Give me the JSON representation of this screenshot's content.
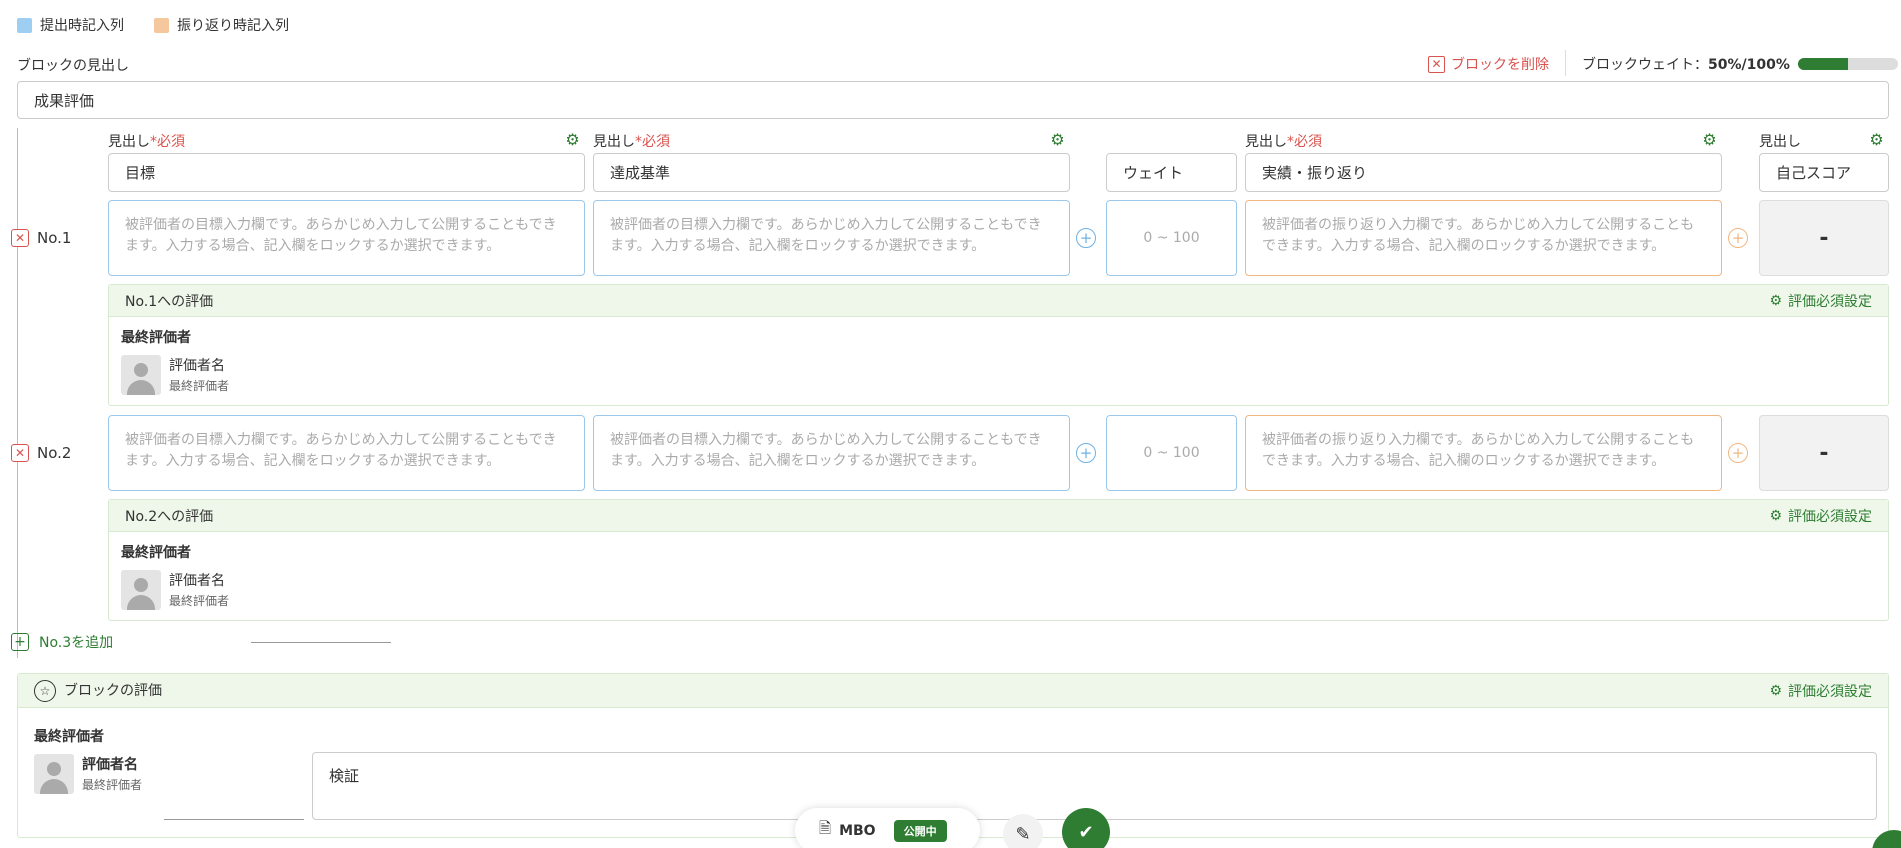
{
  "legend": [
    {
      "label": "提出時記入列",
      "color": "#9ecff3"
    },
    {
      "label": "振り返り時記入列",
      "color": "#f5c79d"
    }
  ],
  "block": {
    "heading_label": "ブロックの見出し",
    "title_value": "成果評価",
    "delete_label": "ブロックを削除",
    "weight_label": "ブロックウェイト：",
    "weight_value": "50%/100%",
    "weight_progress": 0.5
  },
  "columns": {
    "heading": "見出し",
    "required": "*必須",
    "goal": "目標",
    "criteria": "達成基準",
    "weight": "ウェイト",
    "result": "実績・振り返り",
    "self_score": "自己スコア"
  },
  "placeholders": {
    "goal": "被評価者の目標入力欄です。あらかじめ入力して公開することもできます。入力する場合、記入欄をロックするか選択できます。",
    "criteria": "被評価者の目標入力欄です。あらかじめ入力して公開することもできます。入力する場合、記入欄をロックするか選択できます。",
    "weight": "0 ~ 100",
    "result": "被評価者の振り返り入力欄です。あらかじめ入力して公開することもできます。入力する場合、記入欄のロックするか選択できます。"
  },
  "rows": [
    {
      "label": "No.1",
      "score": "-",
      "eval_title": "No.1への評価"
    },
    {
      "label": "No.2",
      "score": "-",
      "eval_title": "No.2への評価"
    }
  ],
  "evaluation": {
    "setting_label": "評価必須設定",
    "final_evaluator": "最終評価者",
    "evaluator_name": "評価者名",
    "evaluator_role": "最終評価者"
  },
  "add_row_label": "No.3を追加",
  "block_eval": {
    "title": "ブロックの評価",
    "setting_label": "評価必須設定",
    "final_evaluator": "最終評価者",
    "evaluator_name": "評価者名",
    "evaluator_role": "最終評価者",
    "comment": "検証"
  },
  "bottom_bar": {
    "doc_label": "MBO",
    "status": "公開中"
  }
}
